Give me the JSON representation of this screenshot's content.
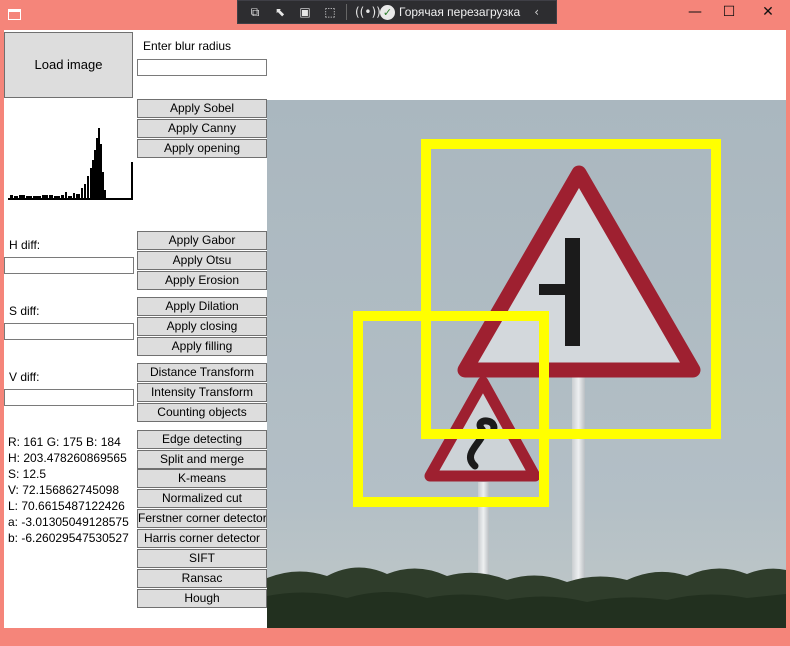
{
  "toolbar_debug": {
    "icons": [
      "live-visual-tree-icon",
      "select-element-icon",
      "display-layout-adorners-icon",
      "track-focused-element-icon",
      "hot-reload-status-icon"
    ],
    "hot_reload_label": "Горячая перезагрузка",
    "collapse_glyph": "‹"
  },
  "window": {
    "minimize_glyph": "—",
    "maximize_glyph": "☐",
    "close_glyph": "✕",
    "title_bar_color": "#f5857a"
  },
  "controls": {
    "load_image_label": "Load image",
    "blur_radius_label": "Enter blur radius",
    "blur_radius_value": "",
    "h_diff_label": "H diff:",
    "h_diff_value": "",
    "s_diff_label": "S diff:",
    "s_diff_value": "",
    "v_diff_label": "V diff:",
    "v_diff_value": ""
  },
  "buttons": [
    "Apply Sobel",
    "Apply Canny",
    "Apply opening",
    "Apply Gabor",
    "Apply Otsu",
    "Apply Erosion",
    "Apply Dilation",
    "Apply closing",
    "Apply filling",
    "Distance Transform",
    "Intensity Transform",
    "Counting objects",
    "Edge detecting",
    "Split and merge",
    "K-means",
    "Normalized cut",
    "Ferstner corner detector",
    "Harris corner detector",
    "SIFT",
    "Ransac",
    "Hough"
  ],
  "readouts": {
    "rgb": "R: 161 G: 175 B: 184",
    "h": "H: 203.478260869565",
    "s": "S: 12.5",
    "v": "V: 72.156862745098",
    "l": "L: 70.6615487122426",
    "a": "a: -3.01305049128575",
    "b": "b: -6.26029547530527"
  },
  "image": {
    "description_name": "road-sign-photo",
    "highlight_color": "#ffff00",
    "sky_color": "#a9b7bf"
  }
}
